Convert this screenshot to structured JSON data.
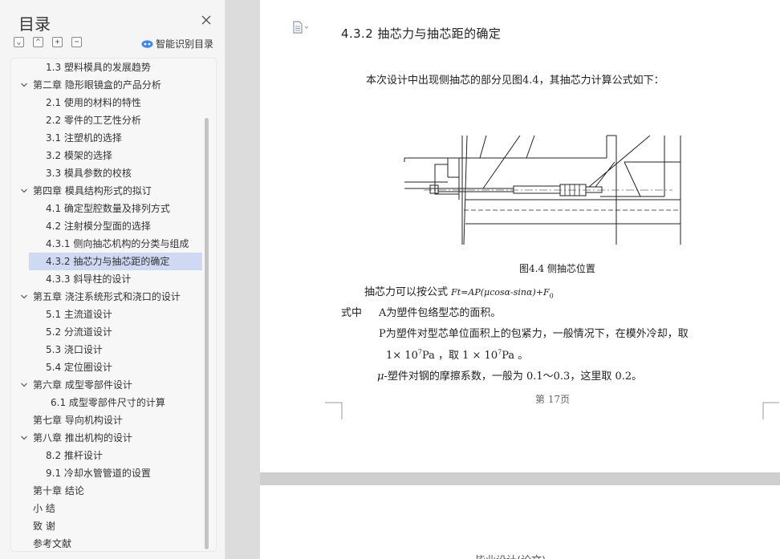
{
  "toc": {
    "title": "目录",
    "smart_label": "智能识别目录",
    "tool_icons": [
      "expand-all-icon",
      "collapse-all-icon",
      "add-heading-icon",
      "remove-heading-icon"
    ],
    "items": [
      {
        "label": "1.3  塑料模具的发展趋势",
        "level": 2,
        "caret": false,
        "active": false
      },
      {
        "label": "第二章  隐形眼镜盒的产品分析",
        "level": 1,
        "caret": true,
        "active": false
      },
      {
        "label": "2.1 使用的材料的特性",
        "level": 2,
        "caret": false,
        "active": false
      },
      {
        "label": "2.2  零件的工艺性分析",
        "level": 2,
        "caret": false,
        "active": false
      },
      {
        "label": "3.1  注塑机的选择",
        "level": 2,
        "caret": false,
        "active": false
      },
      {
        "label": "3.2  模架的选择",
        "level": 2,
        "caret": false,
        "active": false
      },
      {
        "label": "3.3  模具参数的校核",
        "level": 2,
        "caret": false,
        "active": false
      },
      {
        "label": "第四章  模具结构形式的拟订",
        "level": 1,
        "caret": true,
        "active": false
      },
      {
        "label": "4.1  确定型腔数量及排列方式",
        "level": 2,
        "caret": false,
        "active": false
      },
      {
        "label": "4.2  注射模分型面的选择",
        "level": 2,
        "caret": false,
        "active": false
      },
      {
        "label": "4.3.1  侧向抽芯机构的分类与组成",
        "level": 2,
        "caret": false,
        "active": false
      },
      {
        "label": "4.3.2  抽芯力与抽芯距的确定",
        "level": 2,
        "caret": false,
        "active": true
      },
      {
        "label": "4.3.3  斜导柱的设计",
        "level": 2,
        "caret": false,
        "active": false
      },
      {
        "label": "第五章  浇注系统形式和浇口的设计",
        "level": 1,
        "caret": true,
        "active": false
      },
      {
        "label": "5.1 主流道设计",
        "level": 2,
        "caret": false,
        "active": false
      },
      {
        "label": "5.2  分流道设计",
        "level": 2,
        "caret": false,
        "active": false
      },
      {
        "label": "5.3  浇口设计",
        "level": 2,
        "caret": false,
        "active": false
      },
      {
        "label": "5.4  定位圈设计",
        "level": 2,
        "caret": false,
        "active": false
      },
      {
        "label": "第六章  成型零部件设计",
        "level": 1,
        "caret": true,
        "active": false
      },
      {
        "label": "6.1  成型零部件尺寸的计算",
        "level": 3,
        "caret": false,
        "active": false
      },
      {
        "label": "第七章  导向机构设计",
        "level": 1,
        "caret": false,
        "active": false
      },
      {
        "label": "第八章  推出机构的设计",
        "level": 1,
        "caret": true,
        "active": false
      },
      {
        "label": "8.2  推杆设计",
        "level": 2,
        "caret": false,
        "active": false
      },
      {
        "label": "9.1  冷却水管管道的设置",
        "level": 2,
        "caret": false,
        "active": false
      },
      {
        "label": "第十章  结论",
        "level": 1,
        "caret": false,
        "active": false
      },
      {
        "label": "小    结",
        "level": 1,
        "caret": false,
        "active": false
      },
      {
        "label": "致    谢",
        "level": 1,
        "caret": false,
        "active": false
      },
      {
        "label": "参考文献",
        "level": 1,
        "caret": false,
        "active": false
      }
    ]
  },
  "document": {
    "heading": "4.3.2 抽芯力与抽芯距的确定",
    "intro": "本次设计中出现侧抽芯的部分见图4.4，其抽芯力计算公式如下：",
    "figure_caption": "图4.4  侧抽芯位置",
    "formula_lead": "抽芯力可以按公式 ",
    "formula": "Ft=AP(μcosα-sinα)+F",
    "formula_sub": "0",
    "where_label": "式中",
    "def_a": "A为塑件包络型芯的面积。",
    "def_p": "P为塑件对型芯单位面积上的包紧力，一般情况下，在模外冷却，取",
    "def_p2_a": "1× 10",
    "def_p2_exp": "7",
    "def_p2_b": "Pa ，取 1 × 10",
    "def_p2_exp2": "7",
    "def_p2_c": "Pa  。",
    "def_mu_sym": "μ",
    "def_mu": "-塑件对钢的摩擦系数，一般为 0.1～0.3，这里取 0.2。",
    "page_footer": "第 17页"
  },
  "page2": {
    "partial_text": "毕业设计(论文)"
  }
}
